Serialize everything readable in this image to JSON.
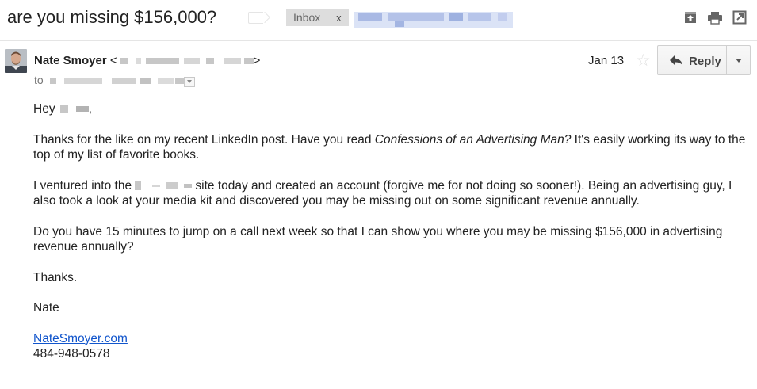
{
  "email": {
    "subject": "are you missing $156,000?",
    "label": {
      "name": "Inbox",
      "remove": "x"
    },
    "sender": {
      "name": "Nate Smoyer",
      "open": "<",
      "close": ">"
    },
    "to_prefix": "to",
    "date": "Jan 13",
    "reply_label": "Reply",
    "body": {
      "greeting_prefix": "Hey",
      "greeting_suffix": ",",
      "p1_before": "Thanks for the like on my recent LinkedIn post. Have you read ",
      "p1_title": "Confessions of an Advertising Man?",
      "p1_after": " It's easily working its way to the top of my list of favorite books.",
      "p2_before": "I ventured into the",
      "p2_after": "site today and created an account (forgive me for not doing so sooner!). Being an advertising guy, I also took a look at your media kit and discovered you may be missing out on some significant revenue annually.",
      "p3": "Do you have 15 minutes to jump on a call next week so that I can show you where you may be missing $156,000 in advertising revenue annually?",
      "p4": "Thanks.",
      "signature_name": "Nate",
      "signature_link": "NateSmoyer.com",
      "signature_phone": "484-948-0578"
    }
  },
  "icons": [
    "label-marker-icon",
    "archive-icon",
    "print-icon",
    "new-window-icon",
    "star-icon",
    "reply-arrow-icon",
    "chevron-down-icon"
  ],
  "colors": {
    "link": "#1155cc",
    "label_chip": "#dddddd",
    "divider": "#e5e5e5",
    "star": "#e0e0e0"
  }
}
